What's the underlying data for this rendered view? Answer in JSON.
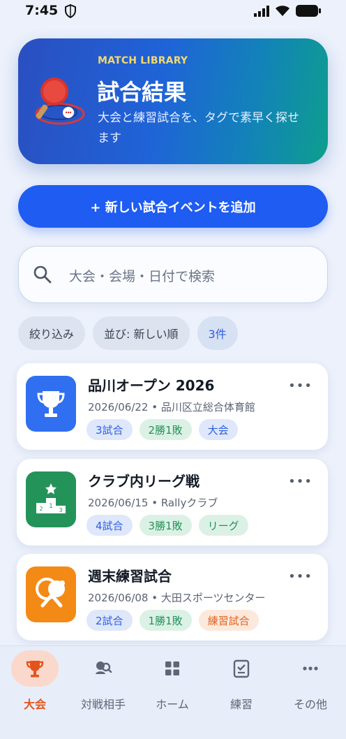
{
  "status": {
    "time": "7:45"
  },
  "hero": {
    "eyebrow": "MATCH LIBRARY",
    "title": "試合結果",
    "description": "大会と練習試合を、タグで素早く探せます"
  },
  "actions": {
    "add_event": "+ 新しい試合イベントを追加"
  },
  "search": {
    "placeholder": "大会・会場・日付で検索"
  },
  "filters": {
    "filter": "絞り込み",
    "sort": "並び: 新しい順",
    "count": "3件"
  },
  "events": [
    {
      "name": "品川オープン 2026",
      "meta": "2026/06/22 • 品川区立総合体育館",
      "tags": [
        "3試合",
        "2勝1敗",
        "大会"
      ],
      "icon": "trophy-icon",
      "color": "#2f6ff0"
    },
    {
      "name": "クラブ内リーグ戦",
      "meta": "2026/06/15 • Rallyクラブ",
      "tags": [
        "4試合",
        "3勝1敗",
        "リーグ"
      ],
      "icon": "podium-icon",
      "color": "#24935a"
    },
    {
      "name": "週末練習試合",
      "meta": "2026/06/08 • 大田スポーツセンター",
      "tags": [
        "2試合",
        "1勝1敗",
        "練習試合"
      ],
      "icon": "pingpong-icon",
      "color": "#f48a16"
    }
  ],
  "nav": [
    {
      "label": "大会",
      "icon": "trophy-icon",
      "active": true
    },
    {
      "label": "対戦相手",
      "icon": "opponents-icon",
      "active": false
    },
    {
      "label": "ホーム",
      "icon": "grid-icon",
      "active": false
    },
    {
      "label": "練習",
      "icon": "checklist-icon",
      "active": false
    },
    {
      "label": "その他",
      "icon": "more-icon",
      "active": false
    }
  ],
  "colors": {
    "accent": "#1e5cf2",
    "active_nav": "#e5531c",
    "eyebrow": "#f4d96a"
  }
}
